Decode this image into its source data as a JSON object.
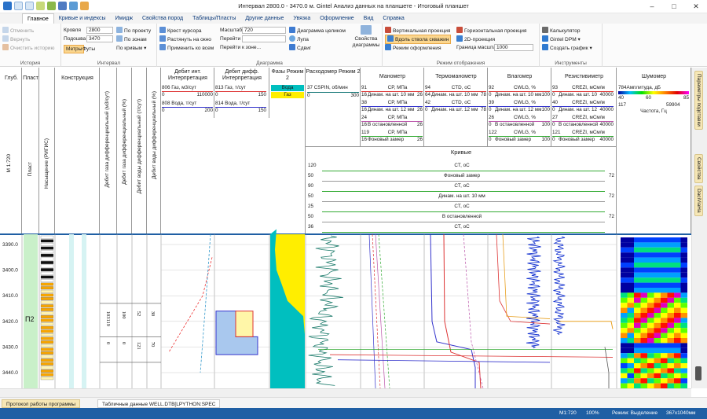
{
  "window": {
    "title": "Интервал 2800.0 - 3470.0 м. Gintel Анализ данных на планшете - Итоговый планшет"
  },
  "tabs": [
    "Главное",
    "Кривые и индексы",
    "Имидж",
    "Свойства пород",
    "Таблицы/Пласты",
    "Другие данные",
    "Увязка",
    "Оформление",
    "Вид",
    "Справка"
  ],
  "ribbon": {
    "history": {
      "caption": "История",
      "items": [
        "Отменить",
        "Вернуть",
        "Очистить историю"
      ]
    },
    "interval": {
      "caption": "Интервал",
      "top_label": "Кровля",
      "top_value": "2800",
      "bottom_label": "Подошва",
      "bottom_value": "3470",
      "units": [
        "Метры",
        "Футы"
      ],
      "by_project": "По проекту",
      "by_zone": "По зонам",
      "by_curves": "По кривым"
    },
    "diagram": {
      "caption": "Диаграмма",
      "cursor_cross": "Крест курсора",
      "stretch": "Растянуть на окно",
      "apply_all": "Применить ко всем",
      "scale_label": "Масштаб",
      "scale_value": "720",
      "goto1": "Перейти",
      "goto2": "Перейти",
      "goto_zone": "Перейти к зоне...",
      "whole_diagram": "Диаграмма целиком",
      "magnifier": "Лупа",
      "shift": "Сдвиг",
      "props": "Свойства диаграммы"
    },
    "display": {
      "caption": "Режим отображения",
      "vertical": "Вертикальная проекция",
      "horizontal": "Горизонтальная проекция",
      "along_well": "Вдоль ствола скважин",
      "proj2d": "2D-проекция",
      "format_mode": "Режим оформления",
      "scale_bound": "Граница масштаба",
      "scale_bound_value": "1000"
    },
    "tools": {
      "caption": "Инструменты",
      "calc": "Калькулятор",
      "dpm": "Gintel DPM",
      "create_chart": "Создать график"
    }
  },
  "tracks": {
    "depth": "Глуб.",
    "depth_scale": "M 1:720",
    "plast": "Пласт",
    "plast_sub": "Пласт",
    "saturation": "Насыщение (РИГИС)",
    "construction": "Конструкция",
    "v_gas": "Дебит газа дифференциальный (м3/сут)",
    "v_gas_pct": "Дебит газа дифференциальный (%)",
    "v_water": "Дебит воды дифференциальный (т/сут)",
    "v_water_pct": "Дебит воды дифференциальный (%)",
    "debit_int": "Дебит инт. Интерпретация",
    "debit_diff": "Дебит дифф. Интерпретация",
    "phases": "Фазы Режим 2",
    "flowmeter": "Расходомер Режим 2",
    "manometer": "Манометр",
    "thermometer": "Термоманометр",
    "moisture": "Влагомер",
    "resist": "Резистивиметр",
    "noise": "Шумомер",
    "curves_title": "Кривые"
  },
  "legend": {
    "debit_int": [
      {
        "l": "806  Газ, м3/сут",
        "a": "0",
        "b": "110000"
      },
      {
        "l": "808 Вода, т/сут",
        "a": "0",
        "b": "200"
      }
    ],
    "debit_diff": [
      {
        "l": "813  Газ, т/сут",
        "a": "0",
        "b": "150"
      },
      {
        "l": "814  Вода, т/сут",
        "a": "0",
        "b": "150"
      }
    ],
    "phases": [
      "Вода",
      "Газ"
    ],
    "flowmeter": [
      {
        "l": "37 CSPIN, об/мин",
        "a": "0",
        "b": "300"
      }
    ],
    "manometer": [
      {
        "n": "91",
        "l": "CP, МПа",
        "a": "16",
        "s": "Динам. на шт. 10 мм",
        "b": "26"
      },
      {
        "n": "38",
        "l": "CP, МПа",
        "a": "16",
        "s": "Динам. на шт. 12 мм",
        "b": "26"
      },
      {
        "n": "24",
        "l": "CP, МПа",
        "a": "16",
        "s": "В остановленной",
        "b": "26"
      },
      {
        "n": "119",
        "l": "CP, МПа",
        "a": "16",
        "s": "Фоновый замер",
        "b": "26"
      }
    ],
    "thermometer": [
      {
        "n": "94",
        "l": "CTD, оС",
        "a": "64",
        "s": "Динам. на шт. 10 мм",
        "b": "78"
      },
      {
        "n": "42",
        "l": "CTD, оС",
        "a": "0",
        "s": "Динам. на шт. 12 мм",
        "b": "78"
      }
    ],
    "moisture": [
      {
        "n": "92",
        "l": "CWLG, %",
        "a": "0",
        "s": "Динам. на шт. 10 мм",
        "b": "100"
      },
      {
        "n": "39",
        "l": "CWLG, %",
        "a": "0",
        "s": "Динам. на шт. 12 мм",
        "b": "100"
      },
      {
        "n": "26",
        "l": "CWLG, %",
        "a": "0",
        "s": "В остановленной",
        "b": "100"
      },
      {
        "n": "122",
        "l": "CWLG, %",
        "a": "0",
        "s": "Фоновый замер",
        "b": "100"
      }
    ],
    "resist": [
      {
        "n": "93",
        "l": "CREZI, мСм/м",
        "a": "0",
        "s": "Динам. на шт. 10",
        "b": "40000"
      },
      {
        "n": "40",
        "l": "CREZI, мСм/м",
        "a": "0",
        "s": "Динам. на шт. 12",
        "b": "40000"
      },
      {
        "n": "27",
        "l": "CREZI, мСм/м",
        "a": "0",
        "s": "В остановленной",
        "b": "40000"
      },
      {
        "n": "121",
        "l": "CREZI, мСм/м",
        "a": "0",
        "s": "Фоновый замер",
        "b": "40000"
      }
    ],
    "noise": {
      "l": "784Амплитуда, дБ",
      "s1": "40",
      "s2": "60",
      "s3": "85",
      "f_a": "117",
      "f_b": "59904",
      "f_l": "Частота, Гц"
    }
  },
  "curve_list": [
    {
      "a": "120",
      "l": "CT, оС",
      "b": ""
    },
    {
      "a": "50",
      "l": "Фоновый замер",
      "b": "72"
    },
    {
      "a": "90",
      "l": "CT, оС",
      "b": ""
    },
    {
      "a": "50",
      "l": "Динам. на шт. 10 мм",
      "b": "72"
    },
    {
      "a": "25",
      "l": "CT, оС",
      "b": ""
    },
    {
      "a": "50",
      "l": "В остановленной",
      "b": "72"
    },
    {
      "a": "36",
      "l": "CT, оС",
      "b": ""
    }
  ],
  "depth_ticks": [
    "3390.0",
    "3400.0",
    "3410.0",
    "3420.0",
    "3430.0",
    "3440.0"
  ],
  "plast_label": "П2",
  "table_vals": {
    "gas": "103119",
    "gas_pct": "100",
    "water": "52",
    "water_pct": "30",
    "r2a": "0",
    "r2b": "0",
    "r2c": "121",
    "r2d": "70"
  },
  "bottom_tabs": [
    "Протокол работы программы",
    "Табличные данные WELL.DTB[LPYTHON:SPEC"
  ],
  "side_tabs": [
    "Параметры подставки",
    "Свойства",
    "DaciViaHa"
  ],
  "status": {
    "scale": "M1:720",
    "zoom": "100%",
    "mode": "Режим: Выделение",
    "size": "367x1040мм"
  },
  "colors": {
    "accent": "#1f5fa4",
    "gas": "#a9c8ee",
    "water": "#fff6a8",
    "phase_gas": "#ffee00",
    "phase_water": "#00bfbf"
  }
}
